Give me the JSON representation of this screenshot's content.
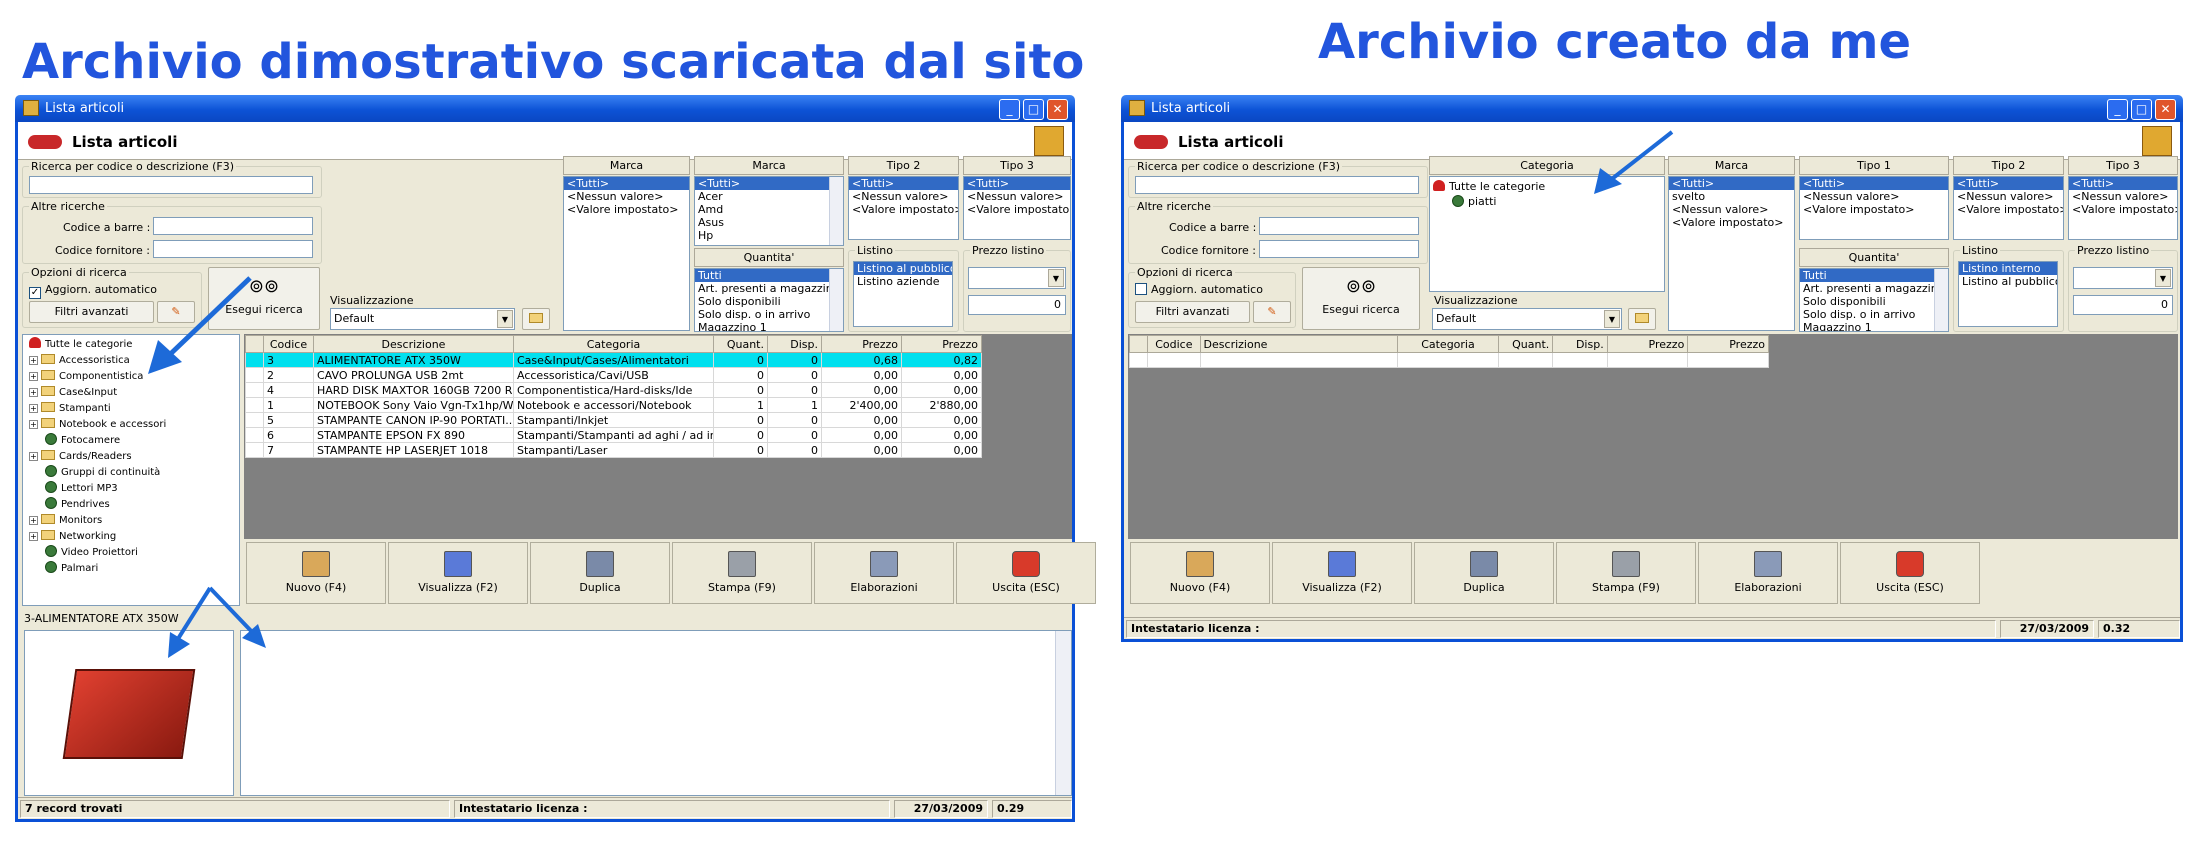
{
  "headings": {
    "left": "Archivio dimostrativo scaricata dal sito",
    "right": "Archivio creato da me"
  },
  "left_window": {
    "title": "Lista articoli",
    "header_title": "Lista articoli",
    "search_label": "Ricerca per codice o descrizione (F3)",
    "altre_label": "Altre ricerche",
    "barcode_label": "Codice a barre :",
    "supplier_label": "Codice fornitore :",
    "options_label": "Opzioni di ricerca",
    "auto_update_label": "Aggiorn. automatico",
    "filter_button": "Filtri avanzati",
    "execute_button": "Esegui ricerca",
    "view_label": "Visualizzazione",
    "view_value": "Default",
    "marca1_header": "Marca",
    "marca1_items": [
      "<Tutti>",
      "<Nessun valore>",
      "<Valore impostato>"
    ],
    "marca2_header": "Marca",
    "marca2_items": [
      "<Tutti>",
      "Acer",
      "Amd",
      "Asus",
      "Hp"
    ],
    "quantita_header": "Quantita'",
    "quantita_items": [
      "Tutti",
      "Art. presenti a magazzino",
      "Solo disponibili",
      "Solo disp. o in arrivo",
      "Magazzino 1"
    ],
    "tipo2_header": "Tipo 2",
    "tipo2_items": [
      "<Tutti>",
      "<Nessun valore>",
      "<Valore impostato>"
    ],
    "tipo3_header": "Tipo 3",
    "tipo3_items": [
      "<Tutti>",
      "<Nessun valore>",
      "<Valore impostato>"
    ],
    "listino_label": "Listino",
    "listino_items": [
      "Listino al pubblico",
      "Listino aziende"
    ],
    "prezzo_label": "Prezzo listino",
    "prezzo_value": "0",
    "tree": [
      {
        "type": "root",
        "label": "Tutte le categorie"
      },
      {
        "type": "folder",
        "label": "Accessoristica"
      },
      {
        "type": "folder",
        "label": "Componentistica"
      },
      {
        "type": "folder",
        "label": "Case&Input"
      },
      {
        "type": "folder",
        "label": "Stampanti"
      },
      {
        "type": "folder",
        "label": "Notebook e accessori"
      },
      {
        "type": "leaf",
        "label": "Fotocamere"
      },
      {
        "type": "folder",
        "label": "Cards/Readers"
      },
      {
        "type": "leaf",
        "label": "Gruppi di continuità"
      },
      {
        "type": "leaf",
        "label": "Lettori MP3"
      },
      {
        "type": "leaf",
        "label": "Pendrives"
      },
      {
        "type": "folder",
        "label": "Monitors"
      },
      {
        "type": "folder",
        "label": "Networking"
      },
      {
        "type": "leaf",
        "label": "Video Proiettori"
      },
      {
        "type": "leaf",
        "label": "Palmari"
      }
    ],
    "columns": [
      "",
      "Codice",
      "Descrizione",
      "Categoria",
      "Quant.",
      "Disp.",
      "Prezzo",
      "Prezzo"
    ],
    "rows": [
      [
        "",
        "3",
        "ALIMENTATORE ATX 350W",
        "Case&Input/Cases/Alimentatori",
        "0",
        "0",
        "0,68",
        "0,82"
      ],
      [
        "",
        "2",
        "CAVO PROLUNGA USB 2mt",
        "Accessoristica/Cavi/USB",
        "0",
        "0",
        "0,00",
        "0,00"
      ],
      [
        "",
        "4",
        "HARD DISK MAXTOR 160GB 7200 R...",
        "Componentistica/Hard-disks/Ide",
        "0",
        "0",
        "0,00",
        "0,00"
      ],
      [
        "",
        "1",
        "NOTEBOOK Sony Vaio Vgn-Tx1hp/W",
        "Notebook e accessori/Notebook",
        "1",
        "1",
        "2'400,00",
        "2'880,00"
      ],
      [
        "",
        "5",
        "STAMPANTE CANON IP-90 PORTATI...",
        "Stampanti/Inkjet",
        "0",
        "0",
        "0,00",
        "0,00"
      ],
      [
        "",
        "6",
        "STAMPANTE EPSON FX 890",
        "Stampanti/Stampanti ad aghi / ad impa...",
        "0",
        "0",
        "0,00",
        "0,00"
      ],
      [
        "",
        "7",
        "STAMPANTE HP LASERJET 1018",
        "Stampanti/Laser",
        "0",
        "0",
        "0,00",
        "0,00"
      ]
    ],
    "toolbar": [
      "Nuovo (F4)",
      "Visualizza (F2)",
      "Duplica",
      "Stampa (F9)",
      "Elaborazioni",
      "Uscita (ESC)"
    ],
    "detail_label": "3-ALIMENTATORE ATX 350W",
    "status_records": "7 record trovati",
    "status_license": "Intestatario licenza :",
    "status_date": "27/03/2009",
    "status_version": "0.29"
  },
  "right_window": {
    "title": "Lista articoli",
    "header_title": "Lista articoli",
    "search_label": "Ricerca per codice o descrizione (F3)",
    "altre_label": "Altre ricerche",
    "barcode_label": "Codice a barre :",
    "supplier_label": "Codice fornitore :",
    "options_label": "Opzioni di ricerca",
    "auto_update_label": "Aggiorn. automatico",
    "filter_button": "Filtri avanzati",
    "execute_button": "Esegui ricerca",
    "view_label": "Visualizzazione",
    "view_value": "Default",
    "categoria_header": "Categoria",
    "categoria_tree": [
      "Tutte le categorie",
      "piatti"
    ],
    "marca_header": "Marca",
    "marca_items": [
      "<Tutti>",
      "svelto",
      "<Nessun valore>",
      "<Valore impostato>"
    ],
    "tipo1_header": "Tipo 1",
    "tipo1_items": [
      "<Tutti>",
      "<Nessun valore>",
      "<Valore impostato>"
    ],
    "tipo2_header": "Tipo 2",
    "tipo2_items": [
      "<Tutti>",
      "<Nessun valore>",
      "<Valore impostato>"
    ],
    "tipo3_header": "Tipo 3",
    "tipo3_items": [
      "<Tutti>",
      "<Nessun valore>",
      "<Valore impostato>"
    ],
    "quantita_header": "Quantita'",
    "quantita_items": [
      "Tutti",
      "Art. presenti a magazzino",
      "Solo disponibili",
      "Solo disp. o in arrivo",
      "Magazzino 1"
    ],
    "listino_label": "Listino",
    "listino_items": [
      "Listino interno",
      "Listino al pubblico"
    ],
    "prezzo_label": "Prezzo listino",
    "prezzo_value": "0",
    "columns": [
      "",
      "Codice",
      "Descrizione",
      "Categoria",
      "Quant.",
      "Disp.",
      "Prezzo",
      "Prezzo"
    ],
    "toolbar": [
      "Nuovo (F4)",
      "Visualizza (F2)",
      "Duplica",
      "Stampa (F9)",
      "Elaborazioni",
      "Uscita (ESC)"
    ],
    "status_license": "Intestatario licenza :",
    "status_date": "27/03/2009",
    "status_version": "0.32"
  },
  "colors": {
    "heading": "#2255dd",
    "titlebar": "#0d53d6",
    "selection": "#316ac5",
    "row_highlight": "#00e0ee",
    "arrow": "#1d6ad8"
  }
}
